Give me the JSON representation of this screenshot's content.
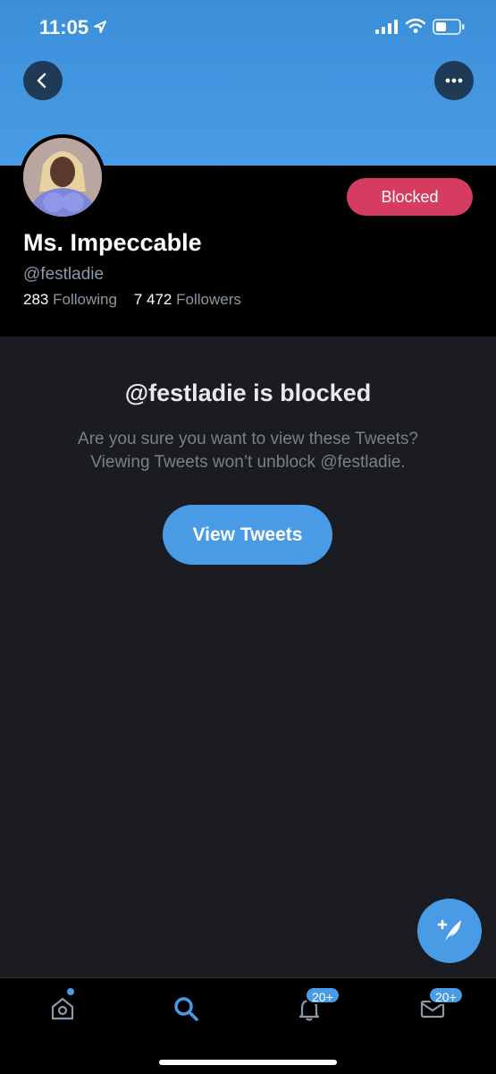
{
  "status_bar": {
    "time": "11:05"
  },
  "profile": {
    "display_name": "Ms. Impeccable",
    "handle": "@festladie",
    "following_count": "283",
    "following_label": "Following",
    "followers_count": "7 472",
    "followers_label": "Followers",
    "blocked_button_label": "Blocked"
  },
  "block_notice": {
    "title": "@festladie is blocked",
    "message_line1": "Are you sure you want to view these Tweets?",
    "message_line2": "Viewing Tweets won’t unblock @festladie.",
    "view_button_label": "View Tweets"
  },
  "tabbar": {
    "notifications_badge": "20+",
    "messages_badge": "20+"
  },
  "colors": {
    "accent": "#4a9be6",
    "blocked": "#d63b60",
    "banner": "#4a9be6"
  },
  "icons": [
    "back-arrow-icon",
    "more-icon",
    "location-arrow-icon",
    "signal-icon",
    "wifi-icon",
    "battery-icon",
    "compose-tweet-icon",
    "home-icon",
    "search-icon",
    "bell-icon",
    "mail-icon"
  ]
}
